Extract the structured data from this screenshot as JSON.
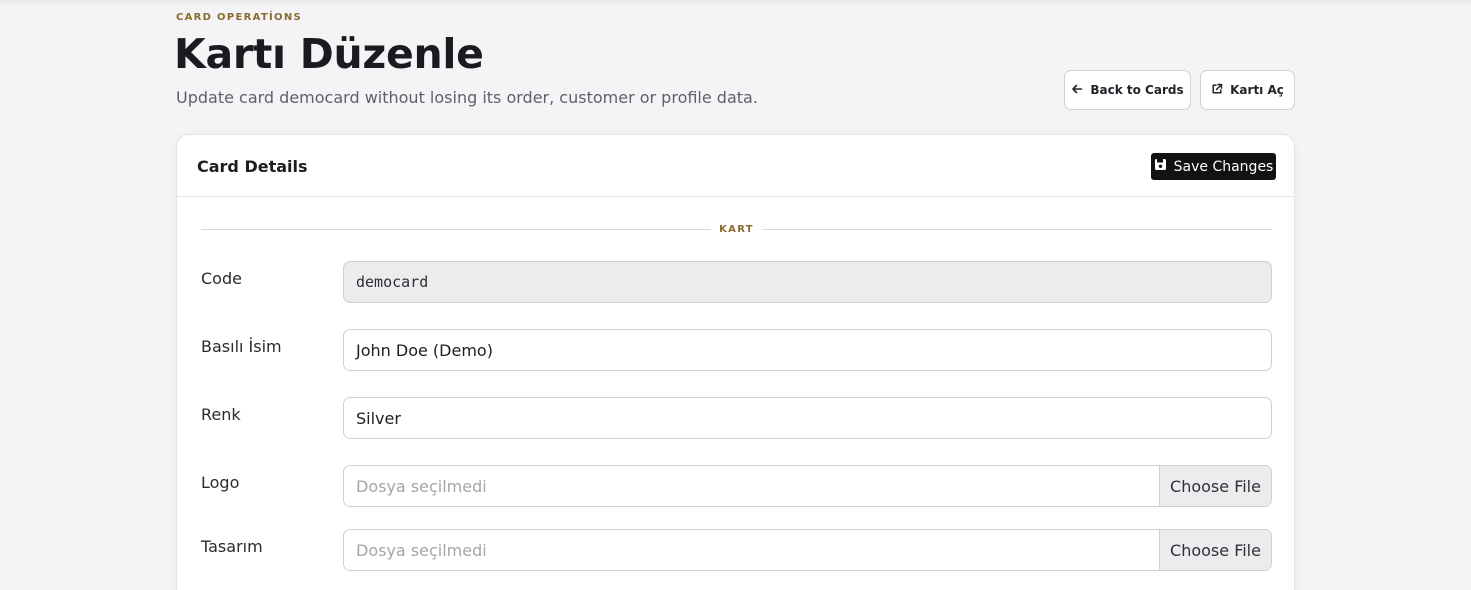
{
  "header": {
    "eyebrow": "CARD OPERATİONS",
    "title": "Kartı Düzenle",
    "subtitle": "Update card democard without losing its order, customer or profile data.",
    "back_button": "Back to Cards",
    "open_button": "Kartı Aç"
  },
  "card": {
    "title": "Card Details",
    "save_button": "Save Changes",
    "section_label": "KART",
    "fields": [
      {
        "label": "Code",
        "value": "democard",
        "readonly": true
      },
      {
        "label": "Basılı İsim",
        "value": "John Doe (Demo)"
      },
      {
        "label": "Renk",
        "value": "Silver"
      },
      {
        "label": "Logo",
        "placeholder": "Dosya seçilmedi",
        "button": "Choose File"
      },
      {
        "label": "Tasarım",
        "placeholder": "Dosya seçilmedi",
        "button": "Choose File"
      }
    ]
  },
  "colors": {
    "accent": "#8a6a2e",
    "primary_button": "#121214",
    "background": "#f4f4f6"
  },
  "icons": {
    "back": "arrow-left-icon",
    "open": "external-link-icon",
    "save": "floppy-disk-icon"
  }
}
